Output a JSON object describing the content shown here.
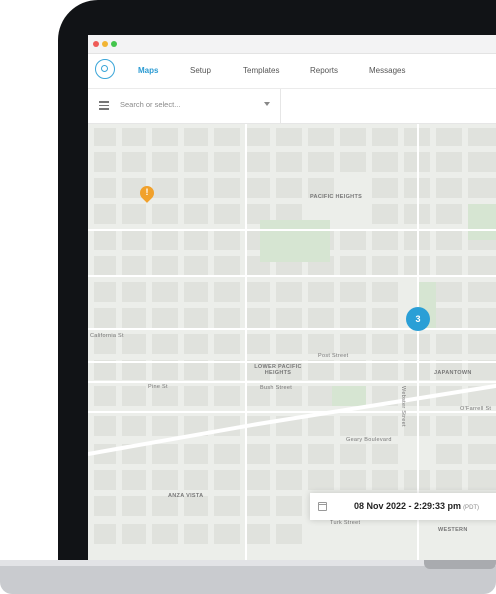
{
  "nav": {
    "tabs": [
      {
        "label": "Maps"
      },
      {
        "label": "Setup"
      },
      {
        "label": "Templates"
      },
      {
        "label": "Reports"
      },
      {
        "label": "Messages"
      }
    ],
    "active": "Maps"
  },
  "toolbar": {
    "search_placeholder": "Search or select..."
  },
  "map": {
    "labels": {
      "pacific_heights": "PACIFIC HEIGHTS",
      "lower_pacific_heights": "LOWER PACIFIC\nHEIGHTS",
      "japantown": "JAPANTOWN",
      "anza_vista": "ANZA VISTA",
      "western": "WESTERN",
      "california_st": "California St",
      "pine_st": "Pine St",
      "bush_st": "Bush Street",
      "post_st": "Post Street",
      "geary_blvd": "Geary Boulevard",
      "ofarrell_st": "O'Farrell St",
      "turk_st": "Turk Street",
      "webster_st": "Webster Street"
    },
    "cluster_count": "3",
    "alert_pin": "!"
  },
  "timestamp": {
    "value": "08 Nov 2022 - 2:29:33 pm",
    "zone": "(PDT)"
  },
  "colors": {
    "accent": "#2b9bd3",
    "alert": "#f1a12b",
    "cluster": "#2a9fd6"
  }
}
